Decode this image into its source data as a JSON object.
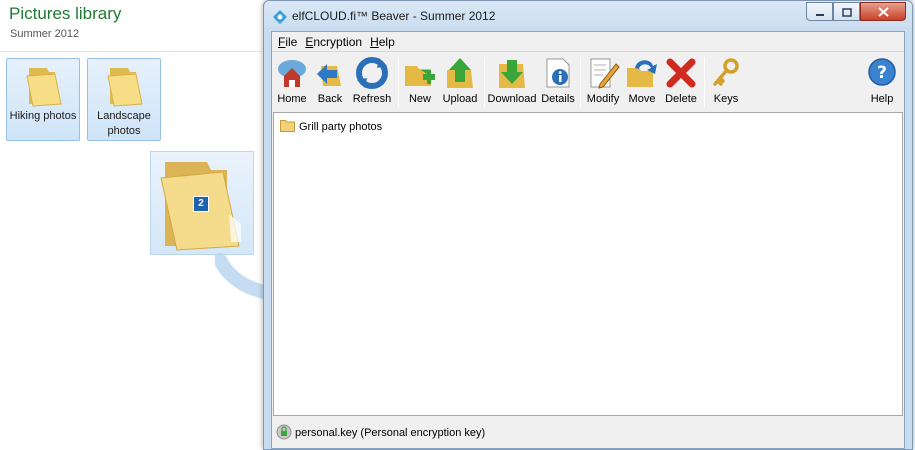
{
  "explorer": {
    "title": "Pictures library",
    "subtitle": "Summer 2012",
    "folders": [
      {
        "label": "Hiking photos"
      },
      {
        "label": "Landscape photos"
      }
    ],
    "drag_count": "2",
    "icons": {
      "folder": "folder-icon",
      "drag_arrow": "drag-arrow-icon"
    }
  },
  "window": {
    "title": "elfCLOUD.fi™ Beaver - Summer 2012",
    "app_icon": "elfcloud-logo-icon",
    "caption": {
      "minimize": "minimize-icon",
      "maximize": "maximize-icon",
      "close": "close-icon"
    },
    "menu": [
      {
        "accel": "F",
        "rest": "ile"
      },
      {
        "accel": "E",
        "rest": "ncryption"
      },
      {
        "accel": "H",
        "rest": "elp"
      }
    ],
    "toolbar": {
      "home": "Home",
      "back": "Back",
      "refresh": "Refresh",
      "new": "New",
      "upload": "Upload",
      "download": "Download",
      "details": "Details",
      "modify": "Modify",
      "move": "Move",
      "delete": "Delete",
      "keys": "Keys",
      "help": "Help"
    },
    "items": [
      {
        "name": "Grill party photos",
        "icon": "folder-icon"
      }
    ],
    "status": {
      "text": "personal.key (Personal encryption key)",
      "icon": "key-lock-icon"
    }
  }
}
